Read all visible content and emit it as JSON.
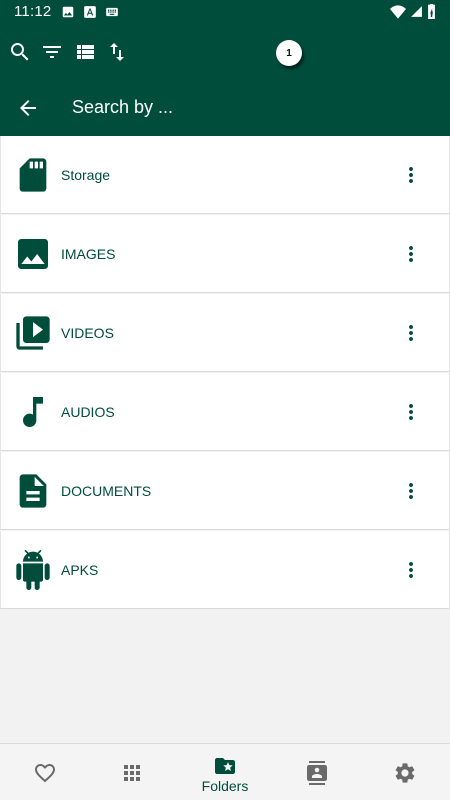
{
  "status_bar": {
    "time": "11:12",
    "notification_icons": [
      "image-icon",
      "font-icon",
      "keyboard-icon"
    ],
    "system_icons": [
      "wifi-icon",
      "signal-icon",
      "battery-icon"
    ]
  },
  "toolbar": {
    "actions": [
      "search-icon",
      "filter-icon",
      "list-view-icon",
      "sort-icon"
    ],
    "selection_count": "1"
  },
  "search": {
    "placeholder": "Search by ..."
  },
  "categories": [
    {
      "label": "Storage",
      "icon": "sd-card-icon"
    },
    {
      "label": "IMAGES",
      "icon": "image-icon"
    },
    {
      "label": "VIDEOS",
      "icon": "video-library-icon"
    },
    {
      "label": "AUDIOS",
      "icon": "music-note-icon"
    },
    {
      "label": "DOCUMENTS",
      "icon": "document-icon"
    },
    {
      "label": "APKS",
      "icon": "android-icon"
    }
  ],
  "bottom_nav": {
    "items": [
      {
        "name": "favorites",
        "icon": "heart-icon"
      },
      {
        "name": "apps",
        "icon": "grid-icon"
      },
      {
        "name": "folders",
        "icon": "folder-star-icon",
        "label": "Folders",
        "active": true
      },
      {
        "name": "contacts",
        "icon": "contacts-icon"
      },
      {
        "name": "settings",
        "icon": "gear-icon"
      }
    ]
  },
  "colors": {
    "primary": "#004d3b",
    "background": "#f2f2f2",
    "inactive_icon": "#6a6a6a"
  }
}
